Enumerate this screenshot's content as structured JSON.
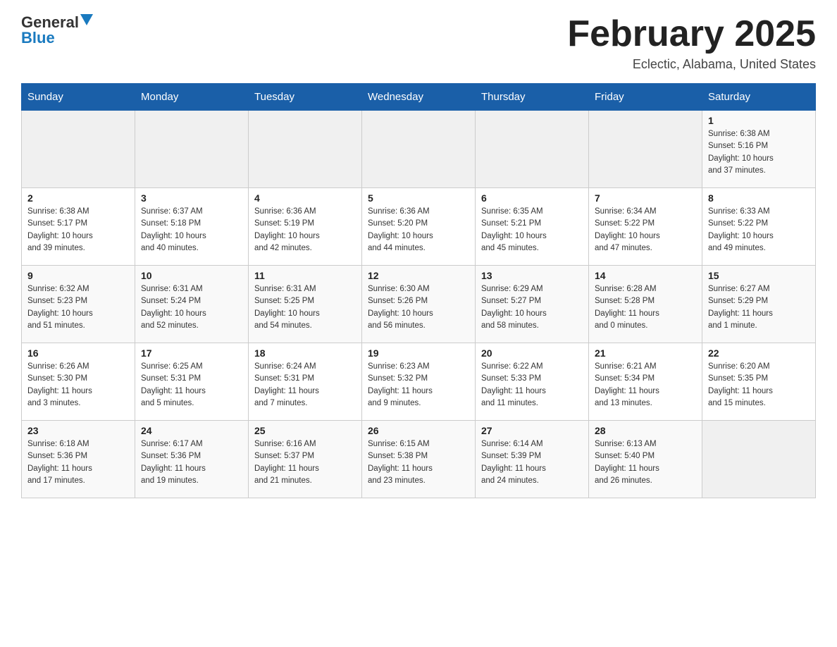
{
  "header": {
    "logo_general": "General",
    "logo_blue": "Blue",
    "month_title": "February 2025",
    "location": "Eclectic, Alabama, United States"
  },
  "weekdays": [
    "Sunday",
    "Monday",
    "Tuesday",
    "Wednesday",
    "Thursday",
    "Friday",
    "Saturday"
  ],
  "weeks": [
    [
      {
        "day": "",
        "info": ""
      },
      {
        "day": "",
        "info": ""
      },
      {
        "day": "",
        "info": ""
      },
      {
        "day": "",
        "info": ""
      },
      {
        "day": "",
        "info": ""
      },
      {
        "day": "",
        "info": ""
      },
      {
        "day": "1",
        "info": "Sunrise: 6:38 AM\nSunset: 5:16 PM\nDaylight: 10 hours\nand 37 minutes."
      }
    ],
    [
      {
        "day": "2",
        "info": "Sunrise: 6:38 AM\nSunset: 5:17 PM\nDaylight: 10 hours\nand 39 minutes."
      },
      {
        "day": "3",
        "info": "Sunrise: 6:37 AM\nSunset: 5:18 PM\nDaylight: 10 hours\nand 40 minutes."
      },
      {
        "day": "4",
        "info": "Sunrise: 6:36 AM\nSunset: 5:19 PM\nDaylight: 10 hours\nand 42 minutes."
      },
      {
        "day": "5",
        "info": "Sunrise: 6:36 AM\nSunset: 5:20 PM\nDaylight: 10 hours\nand 44 minutes."
      },
      {
        "day": "6",
        "info": "Sunrise: 6:35 AM\nSunset: 5:21 PM\nDaylight: 10 hours\nand 45 minutes."
      },
      {
        "day": "7",
        "info": "Sunrise: 6:34 AM\nSunset: 5:22 PM\nDaylight: 10 hours\nand 47 minutes."
      },
      {
        "day": "8",
        "info": "Sunrise: 6:33 AM\nSunset: 5:22 PM\nDaylight: 10 hours\nand 49 minutes."
      }
    ],
    [
      {
        "day": "9",
        "info": "Sunrise: 6:32 AM\nSunset: 5:23 PM\nDaylight: 10 hours\nand 51 minutes."
      },
      {
        "day": "10",
        "info": "Sunrise: 6:31 AM\nSunset: 5:24 PM\nDaylight: 10 hours\nand 52 minutes."
      },
      {
        "day": "11",
        "info": "Sunrise: 6:31 AM\nSunset: 5:25 PM\nDaylight: 10 hours\nand 54 minutes."
      },
      {
        "day": "12",
        "info": "Sunrise: 6:30 AM\nSunset: 5:26 PM\nDaylight: 10 hours\nand 56 minutes."
      },
      {
        "day": "13",
        "info": "Sunrise: 6:29 AM\nSunset: 5:27 PM\nDaylight: 10 hours\nand 58 minutes."
      },
      {
        "day": "14",
        "info": "Sunrise: 6:28 AM\nSunset: 5:28 PM\nDaylight: 11 hours\nand 0 minutes."
      },
      {
        "day": "15",
        "info": "Sunrise: 6:27 AM\nSunset: 5:29 PM\nDaylight: 11 hours\nand 1 minute."
      }
    ],
    [
      {
        "day": "16",
        "info": "Sunrise: 6:26 AM\nSunset: 5:30 PM\nDaylight: 11 hours\nand 3 minutes."
      },
      {
        "day": "17",
        "info": "Sunrise: 6:25 AM\nSunset: 5:31 PM\nDaylight: 11 hours\nand 5 minutes."
      },
      {
        "day": "18",
        "info": "Sunrise: 6:24 AM\nSunset: 5:31 PM\nDaylight: 11 hours\nand 7 minutes."
      },
      {
        "day": "19",
        "info": "Sunrise: 6:23 AM\nSunset: 5:32 PM\nDaylight: 11 hours\nand 9 minutes."
      },
      {
        "day": "20",
        "info": "Sunrise: 6:22 AM\nSunset: 5:33 PM\nDaylight: 11 hours\nand 11 minutes."
      },
      {
        "day": "21",
        "info": "Sunrise: 6:21 AM\nSunset: 5:34 PM\nDaylight: 11 hours\nand 13 minutes."
      },
      {
        "day": "22",
        "info": "Sunrise: 6:20 AM\nSunset: 5:35 PM\nDaylight: 11 hours\nand 15 minutes."
      }
    ],
    [
      {
        "day": "23",
        "info": "Sunrise: 6:18 AM\nSunset: 5:36 PM\nDaylight: 11 hours\nand 17 minutes."
      },
      {
        "day": "24",
        "info": "Sunrise: 6:17 AM\nSunset: 5:36 PM\nDaylight: 11 hours\nand 19 minutes."
      },
      {
        "day": "25",
        "info": "Sunrise: 6:16 AM\nSunset: 5:37 PM\nDaylight: 11 hours\nand 21 minutes."
      },
      {
        "day": "26",
        "info": "Sunrise: 6:15 AM\nSunset: 5:38 PM\nDaylight: 11 hours\nand 23 minutes."
      },
      {
        "day": "27",
        "info": "Sunrise: 6:14 AM\nSunset: 5:39 PM\nDaylight: 11 hours\nand 24 minutes."
      },
      {
        "day": "28",
        "info": "Sunrise: 6:13 AM\nSunset: 5:40 PM\nDaylight: 11 hours\nand 26 minutes."
      },
      {
        "day": "",
        "info": ""
      }
    ]
  ]
}
